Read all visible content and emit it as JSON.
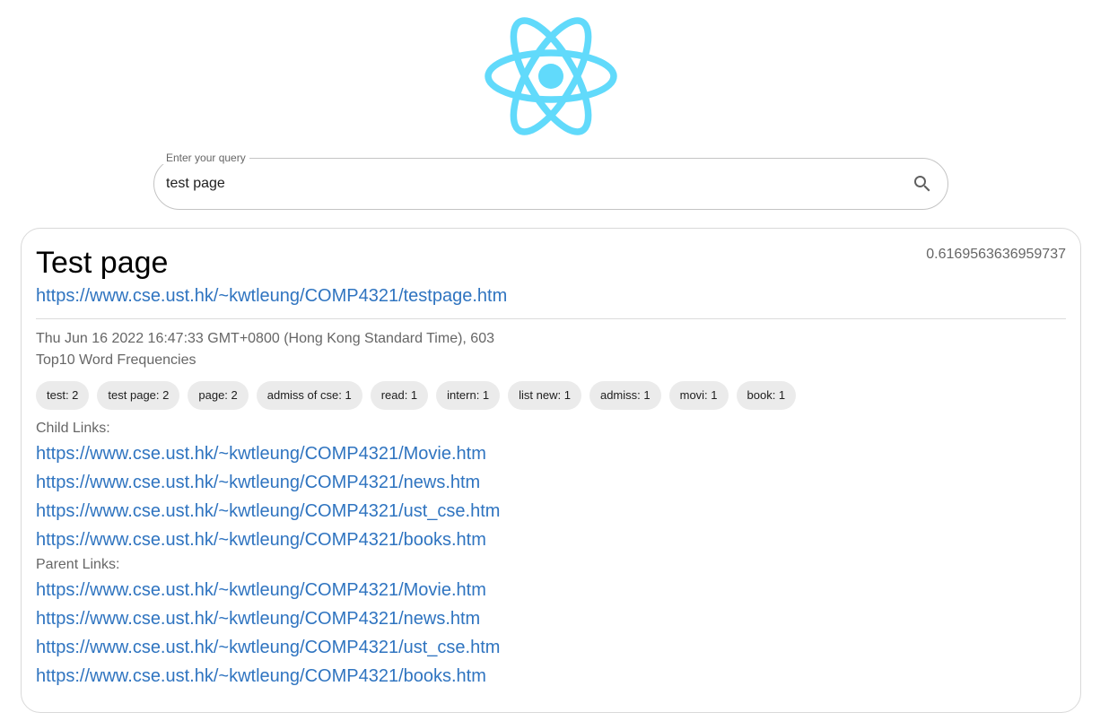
{
  "search": {
    "legend": "Enter your query",
    "value": "test page"
  },
  "result": {
    "title": "Test page",
    "score": "0.6169563636959737",
    "url": "https://www.cse.ust.hk/~kwtleung/COMP4321/testpage.htm",
    "meta": "Thu Jun 16 2022 16:47:33 GMT+0800 (Hong Kong Standard Time), 603",
    "freq_label": "Top10 Word Frequencies",
    "keywords": [
      "test: 2",
      "test page: 2",
      "page: 2",
      "admiss of cse: 1",
      "read: 1",
      "intern: 1",
      "list new: 1",
      "admiss: 1",
      "movi: 1",
      "book: 1"
    ],
    "child_label": "Child Links:",
    "child_links": [
      "https://www.cse.ust.hk/~kwtleung/COMP4321/Movie.htm",
      "https://www.cse.ust.hk/~kwtleung/COMP4321/news.htm",
      "https://www.cse.ust.hk/~kwtleung/COMP4321/ust_cse.htm",
      "https://www.cse.ust.hk/~kwtleung/COMP4321/books.htm"
    ],
    "parent_label": "Parent Links:",
    "parent_links": [
      "https://www.cse.ust.hk/~kwtleung/COMP4321/Movie.htm",
      "https://www.cse.ust.hk/~kwtleung/COMP4321/news.htm",
      "https://www.cse.ust.hk/~kwtleung/COMP4321/ust_cse.htm",
      "https://www.cse.ust.hk/~kwtleung/COMP4321/books.htm"
    ]
  },
  "icons": {
    "logo": "react-logo-icon",
    "search": "search-icon"
  },
  "colors": {
    "logo": "#61dafb",
    "link": "#2f74c0",
    "chip_bg": "#ebebeb",
    "muted_text": "#666666"
  }
}
